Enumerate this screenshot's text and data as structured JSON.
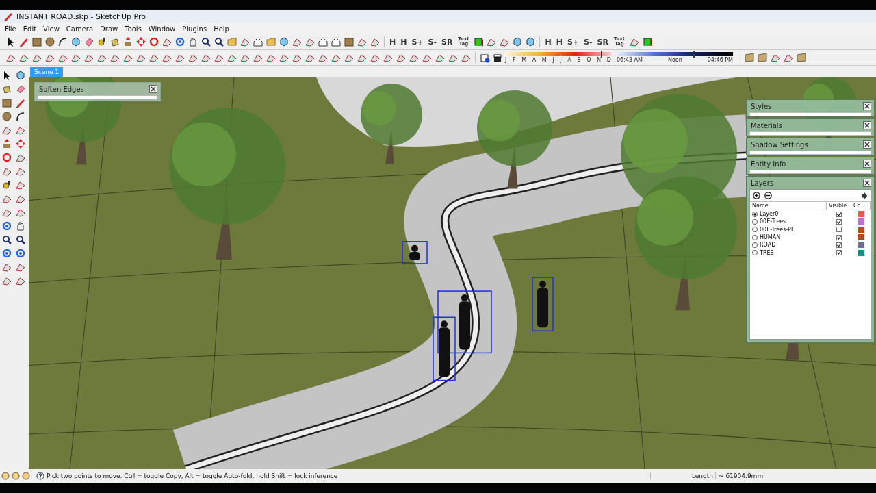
{
  "window": {
    "title": "INSTANT ROAD.skp - SketchUp Pro"
  },
  "menu": [
    "File",
    "Edit",
    "View",
    "Camera",
    "Draw",
    "Tools",
    "Window",
    "Plugins",
    "Help"
  ],
  "toolbar": {
    "glyph_groups": [
      [
        "H",
        "H",
        "S+",
        "S-",
        "SR",
        "Text Tag"
      ],
      [
        "H",
        "H",
        "S+",
        "S-",
        "SR",
        "Text Tag"
      ]
    ]
  },
  "shadow": {
    "months": [
      "J",
      "F",
      "M",
      "A",
      "M",
      "J",
      "J",
      "A",
      "S",
      "O",
      "N",
      "D"
    ],
    "date_slider": {
      "level": 0.9
    },
    "times": [
      "06:43 AM",
      "Noon",
      "04:46 PM"
    ],
    "time_slider": {
      "level": 0.66
    }
  },
  "scenes": [
    {
      "label": "Scene 1",
      "selected": true
    }
  ],
  "soften_edges": {
    "title": "Soften Edges"
  },
  "trays": [
    {
      "title": "Styles"
    },
    {
      "title": "Materials"
    },
    {
      "title": "Shadow Settings"
    },
    {
      "title": "Entity Info"
    }
  ],
  "layers": {
    "title": "Layers",
    "columns": [
      "Name",
      "Visible",
      "Co..."
    ],
    "rows": [
      {
        "name": "Layer0",
        "selected": true,
        "visible": true,
        "color": "#ef5050"
      },
      {
        "name": "00E-Trees",
        "selected": false,
        "visible": true,
        "color": "#c070c8"
      },
      {
        "name": "00E-Trees-PL",
        "selected": false,
        "visible": false,
        "color": "#c84a10"
      },
      {
        "name": "HUMAN",
        "selected": false,
        "visible": true,
        "color": "#b04810"
      },
      {
        "name": "ROAD",
        "selected": false,
        "visible": true,
        "color": "#6e6e98"
      },
      {
        "name": "TREE",
        "selected": false,
        "visible": true,
        "color": "#109080"
      }
    ]
  },
  "status_bar": {
    "hint": "Pick two points to move.  Ctrl = toggle Copy, Alt = toggle Auto-fold, hold Shift = lock inference",
    "length_label": "Length",
    "length_value": "~ 61904.9mm"
  }
}
